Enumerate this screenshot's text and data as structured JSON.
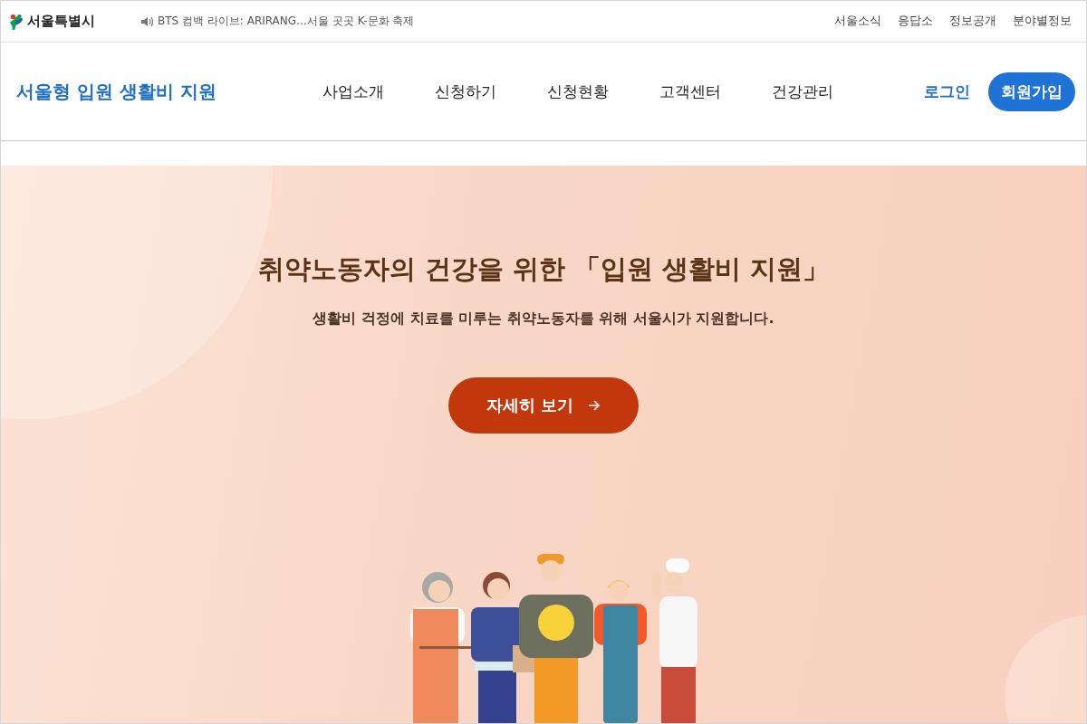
{
  "top_bar": {
    "logo_text": "서울특별시",
    "news_ticker": "BTS 컴백 라이브: ARIRANG…서울 곳곳 K-문화 축제",
    "links": [
      "서울소식",
      "응답소",
      "정보공개",
      "분야별정보"
    ]
  },
  "header": {
    "site_title": "서울형 입원 생활비 지원",
    "nav": [
      "사업소개",
      "신청하기",
      "신청현황",
      "고객센터",
      "건강관리"
    ],
    "login": "로그인",
    "signup": "회원가입"
  },
  "hero": {
    "title": "취약노동자의 건강을 위한 「입원 생활비 지원」",
    "subtitle": "생활비 걱정에 치료를 미루는 취약노동자를 위해 서울시가 지원합니다.",
    "button": "자세히 보기"
  }
}
